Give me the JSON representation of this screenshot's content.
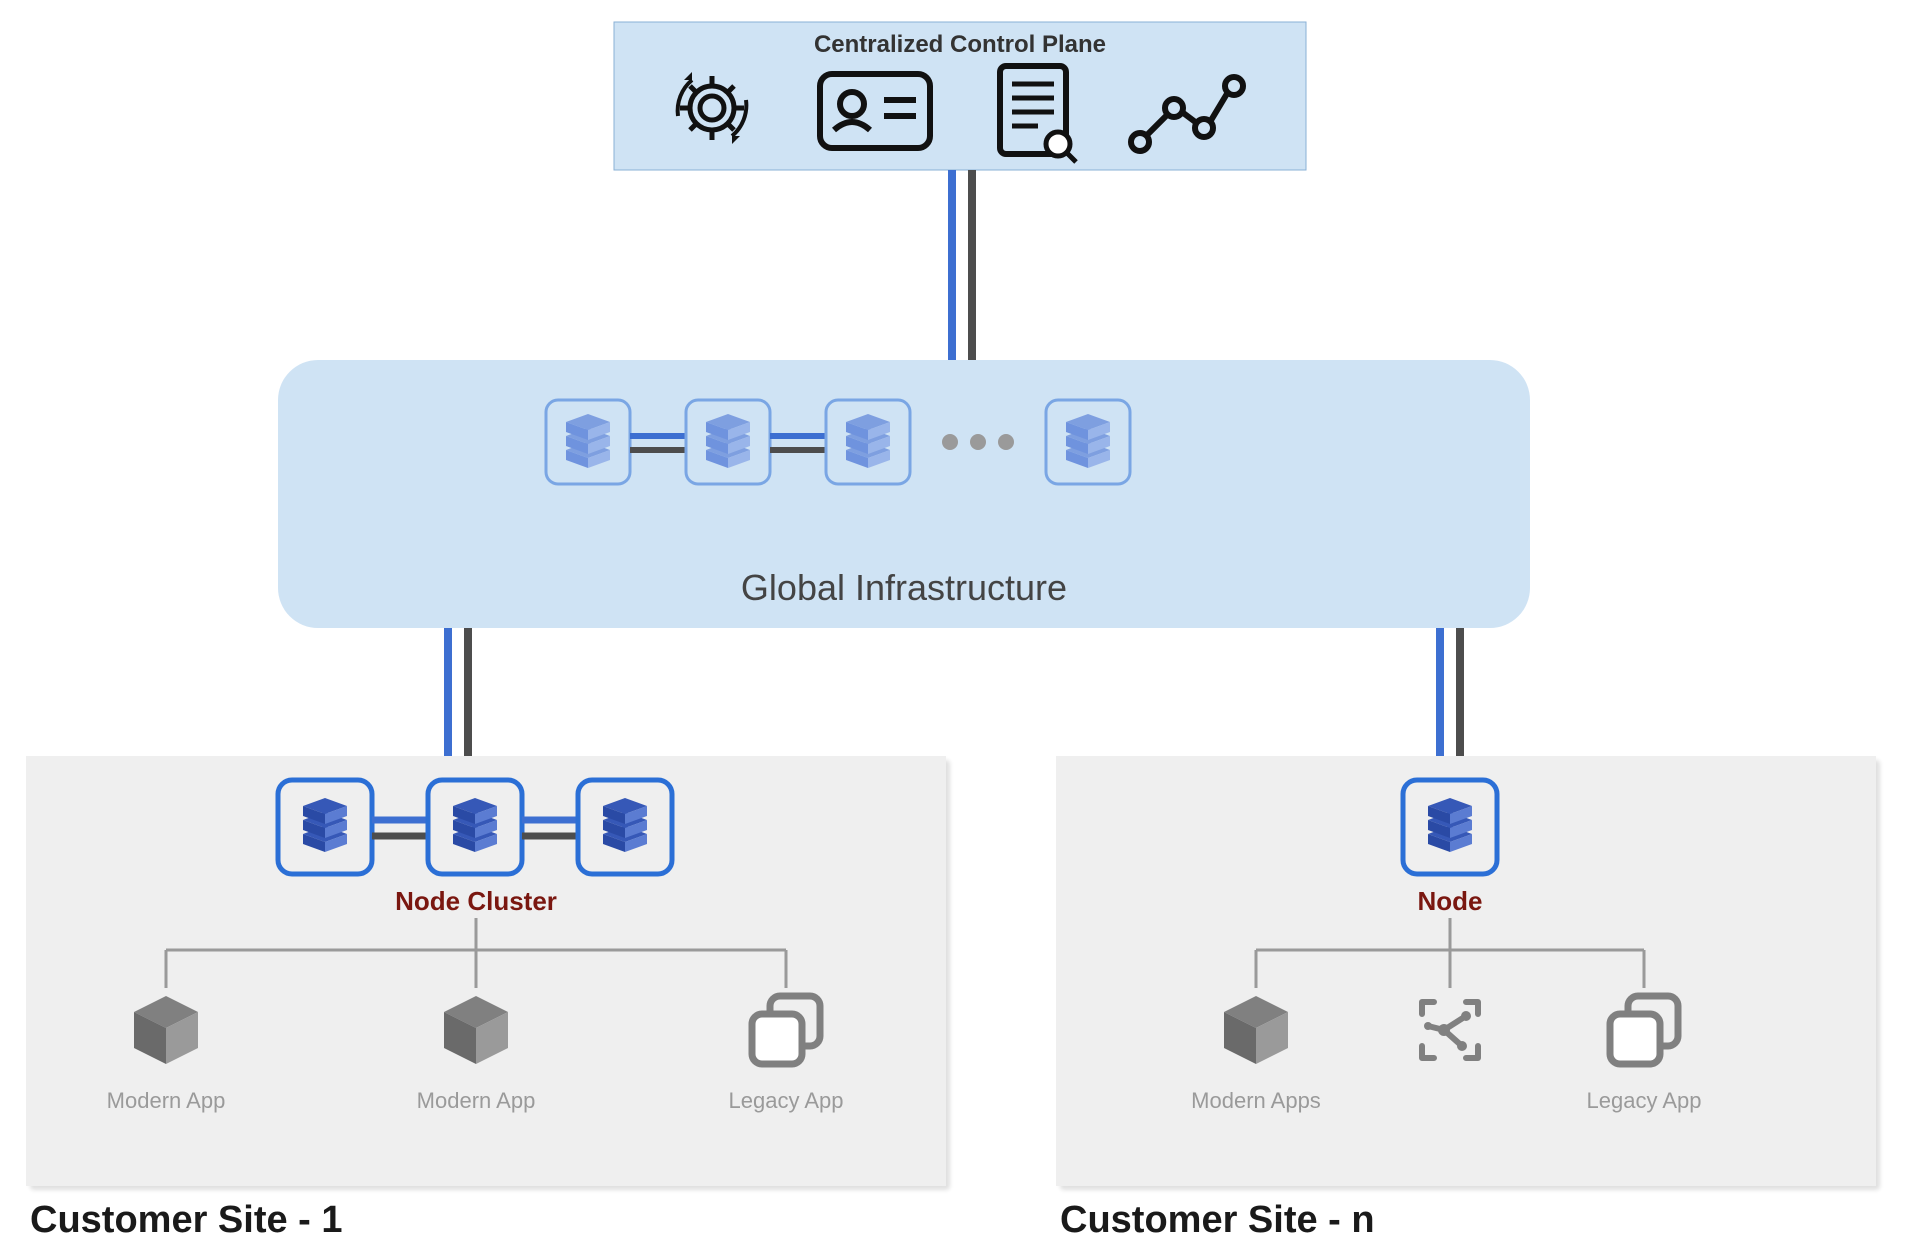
{
  "control_plane": {
    "title": "Centralized Control Plane"
  },
  "global_infra": {
    "title": "Global Infrastructure"
  },
  "site1": {
    "title": "Customer Site - 1",
    "cluster_label": "Node Cluster",
    "apps": [
      "Modern App",
      "Modern App",
      "Legacy App"
    ]
  },
  "site_n": {
    "title": "Customer Site - n",
    "cluster_label": "Node",
    "apps": [
      "Modern Apps",
      "",
      "Legacy App"
    ]
  },
  "colors": {
    "panel_light": "#cfe3f4",
    "panel_card": "#efefef",
    "stack_light": "#98b3e6",
    "stack_dark": "#3e63c9",
    "node_border": "#2b6fd6",
    "link_blue": "#3d6fd1",
    "link_gray": "#4d4d4d",
    "label_red": "#7a1710",
    "headline": "#1a1a1a",
    "caption_gray": "#9a9a9a",
    "icon_gray": "#808080"
  }
}
